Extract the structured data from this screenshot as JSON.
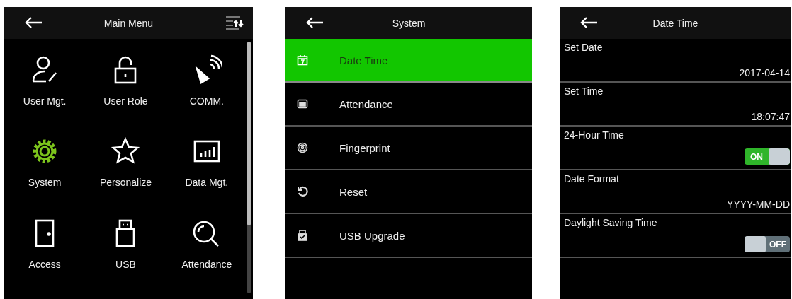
{
  "main_menu": {
    "title": "Main Menu",
    "items": [
      {
        "label": "User Mgt.",
        "selected": false
      },
      {
        "label": "User Role",
        "selected": false
      },
      {
        "label": "COMM.",
        "selected": false
      },
      {
        "label": "System",
        "selected": true
      },
      {
        "label": "Personalize",
        "selected": false
      },
      {
        "label": "Data Mgt.",
        "selected": false
      },
      {
        "label": "Access",
        "selected": false
      },
      {
        "label": "USB",
        "selected": false
      },
      {
        "label": "Attendance",
        "selected": false
      }
    ]
  },
  "system": {
    "title": "System",
    "items": [
      {
        "label": "Date Time",
        "selected": true
      },
      {
        "label": "Attendance",
        "selected": false
      },
      {
        "label": "Fingerprint",
        "selected": false
      },
      {
        "label": "Reset",
        "selected": false
      },
      {
        "label": "USB Upgrade",
        "selected": false
      }
    ]
  },
  "date_time": {
    "title": "Date Time",
    "settings": [
      {
        "kind": "value",
        "label": "Set Date",
        "value": "2017-04-14"
      },
      {
        "kind": "value",
        "label": "Set Time",
        "value": "18:07:47"
      },
      {
        "kind": "toggle",
        "label": "24-Hour Time",
        "on": true,
        "state_text": "ON"
      },
      {
        "kind": "value",
        "label": "Date Format",
        "value": "YYYY-MM-DD"
      },
      {
        "kind": "toggle",
        "label": "Daylight Saving Time",
        "on": false,
        "state_text": "OFF"
      }
    ]
  }
}
